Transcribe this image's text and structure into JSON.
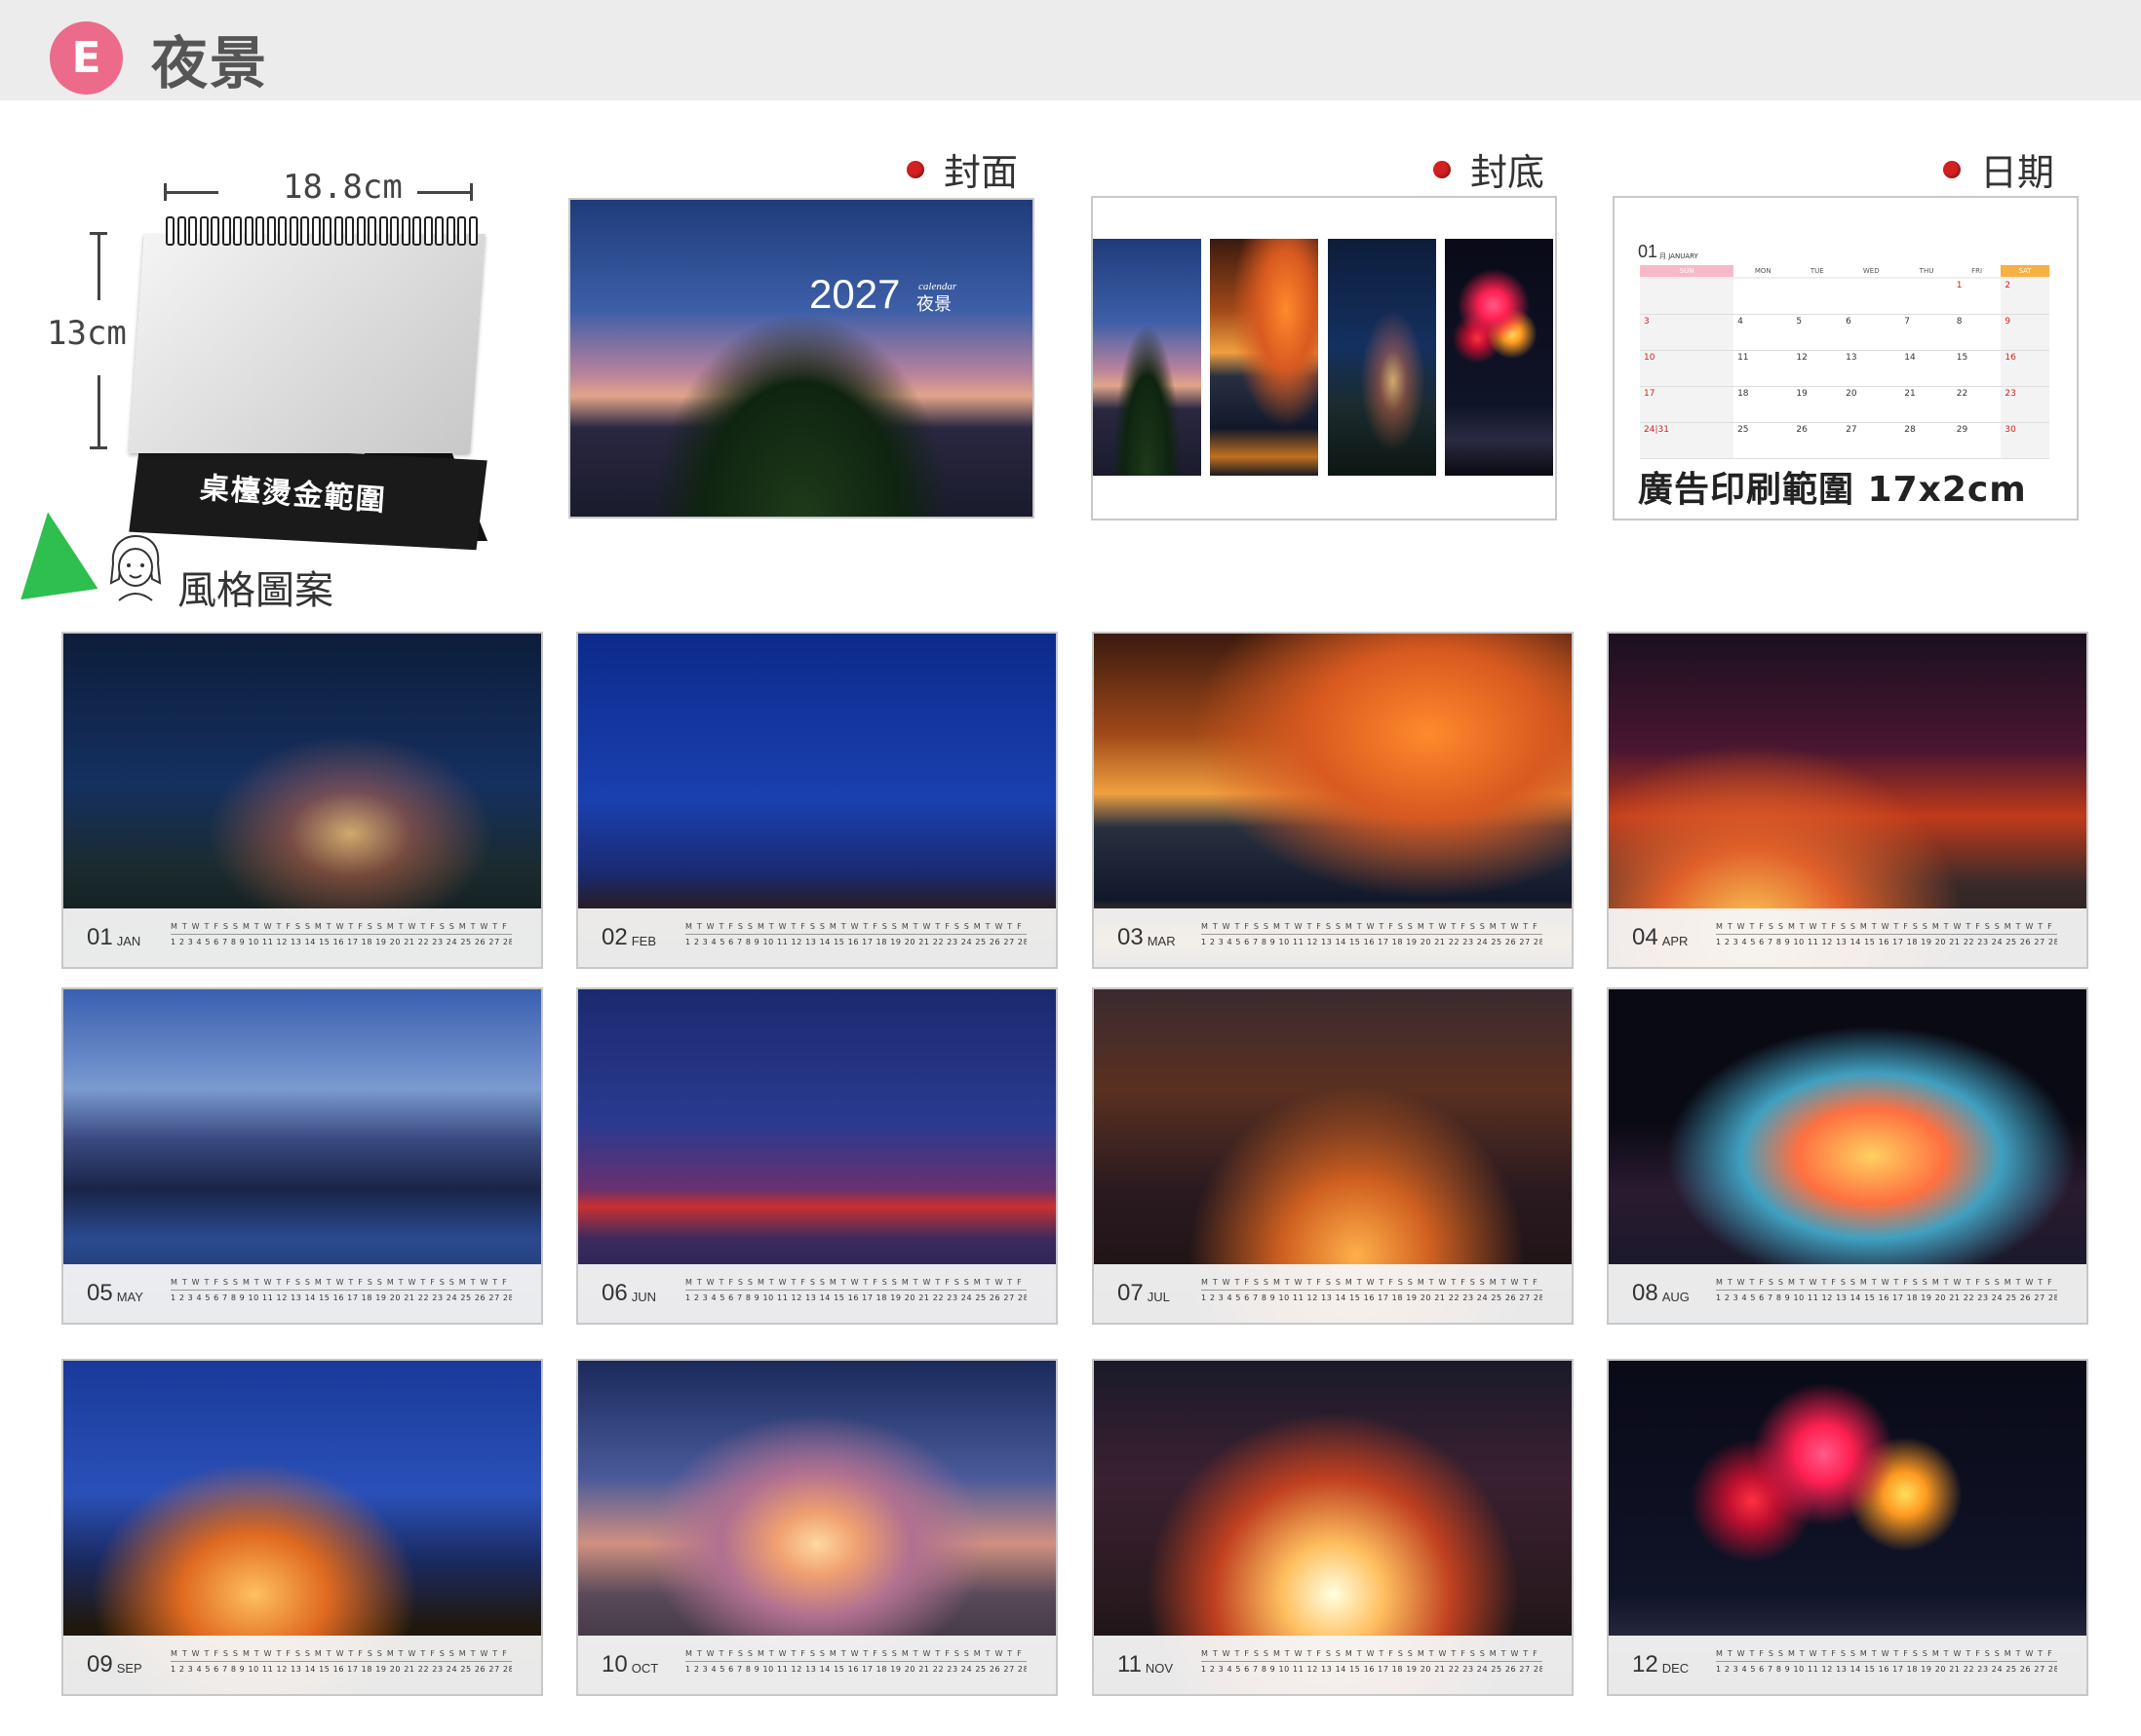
{
  "header": {
    "badge": "E",
    "title": "夜景"
  },
  "dimensions": {
    "width": "18.8cm",
    "height": "13cm",
    "hot_label": "桌檯燙金範圍"
  },
  "style_heading": "風格圖案",
  "sections": {
    "cover": "封面",
    "back": "封底",
    "date": "日期"
  },
  "cover": {
    "year": "2027",
    "calendar_word": "calendar",
    "theme": "夜景"
  },
  "date_preview": {
    "month_num": "01",
    "month_name": "月 JANUARY",
    "weekdays": [
      "SUN",
      "MON",
      "TUE",
      "WED",
      "THU",
      "FRI",
      "SAT"
    ],
    "ad_text": "廣告印刷範圍 17x2cm"
  },
  "months": [
    {
      "num": "01",
      "name": "JAN"
    },
    {
      "num": "02",
      "name": "FEB"
    },
    {
      "num": "03",
      "name": "MAR"
    },
    {
      "num": "04",
      "name": "APR"
    },
    {
      "num": "05",
      "name": "MAY"
    },
    {
      "num": "06",
      "name": "JUN"
    },
    {
      "num": "07",
      "name": "JUL"
    },
    {
      "num": "08",
      "name": "AUG"
    },
    {
      "num": "09",
      "name": "SEP"
    },
    {
      "num": "10",
      "name": "OCT"
    },
    {
      "num": "11",
      "name": "NOV"
    },
    {
      "num": "12",
      "name": "DEC"
    }
  ]
}
